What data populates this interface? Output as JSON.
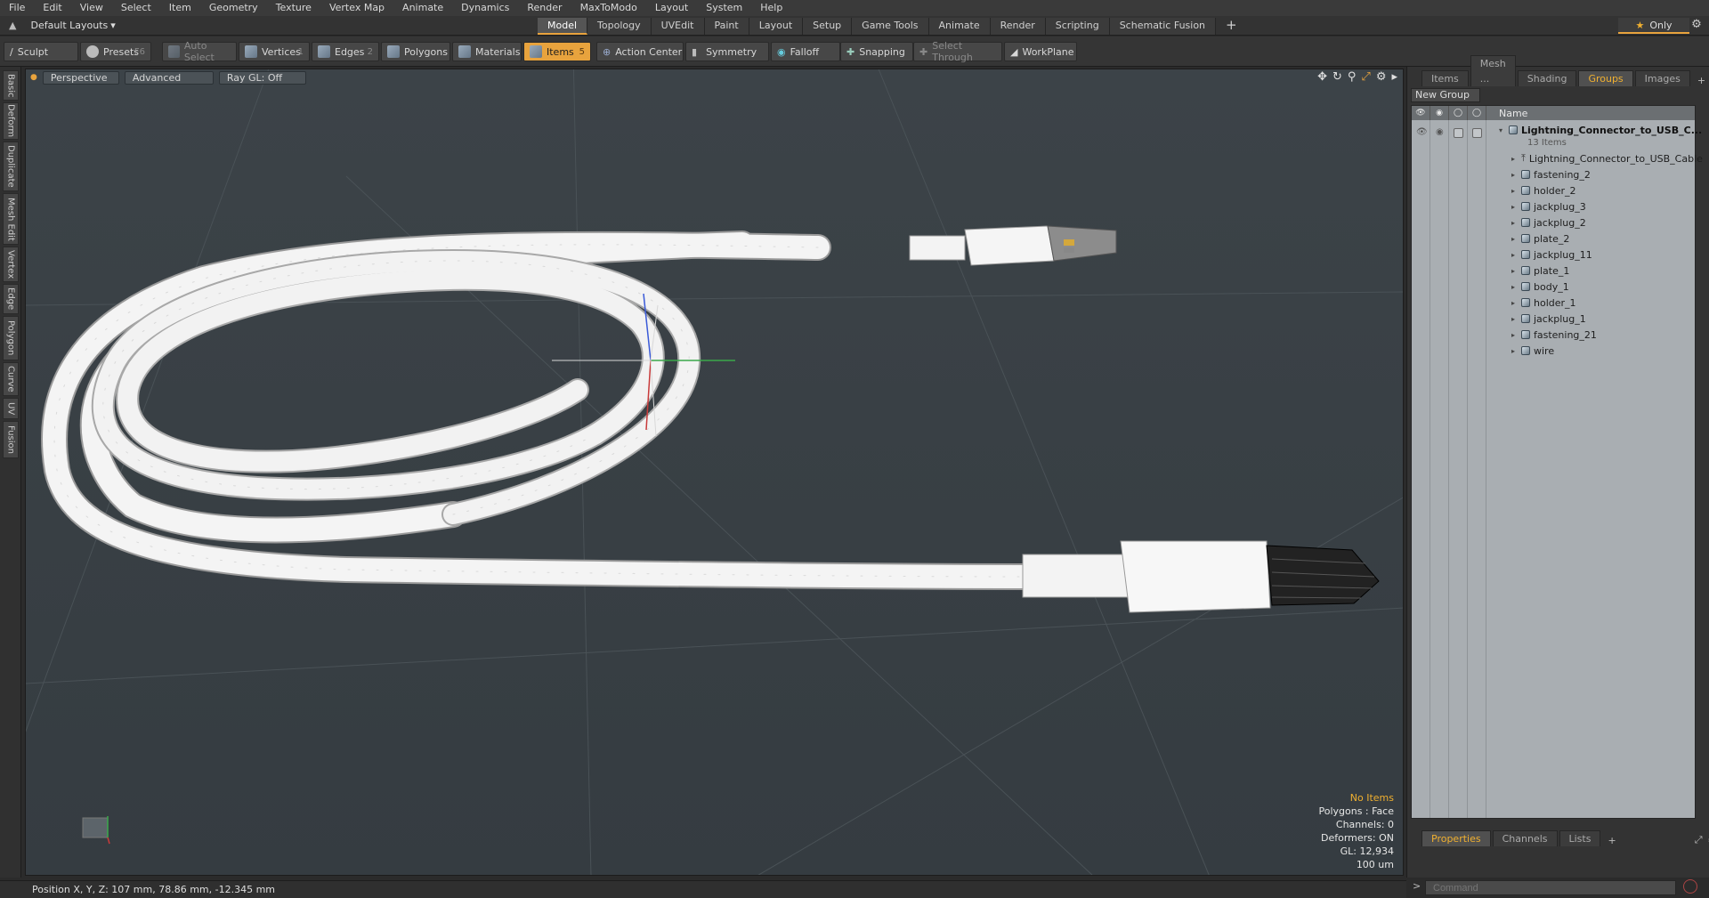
{
  "menu": [
    "File",
    "Edit",
    "View",
    "Select",
    "Item",
    "Geometry",
    "Texture",
    "Vertex Map",
    "Animate",
    "Dynamics",
    "Render",
    "MaxToModo",
    "Layout",
    "System",
    "Help"
  ],
  "layout_selector": "Default Layouts",
  "mode_tabs": [
    "Model",
    "Topology",
    "UVEdit",
    "Paint",
    "Layout",
    "Setup",
    "Game Tools",
    "Animate",
    "Render",
    "Scripting",
    "Schematic Fusion"
  ],
  "active_mode_tab": "Model",
  "only_label": "Only",
  "toolbar": {
    "sculpt": "Sculpt",
    "presets": "Presets",
    "presets_key": "F6",
    "auto_select": "Auto Select",
    "vertices": "Vertices",
    "vertices_key": "1",
    "edges": "Edges",
    "edges_key": "2",
    "polygons": "Polygons",
    "materials": "Materials",
    "items": "Items",
    "items_key": "5",
    "action_center": "Action Center",
    "symmetry": "Symmetry",
    "falloff": "Falloff",
    "snapping": "Snapping",
    "select_through": "Select Through",
    "workplane": "WorkPlane"
  },
  "left_tabs": [
    "Basic",
    "Deform",
    "Duplicate",
    "Mesh Edit",
    "Vertex",
    "Edge",
    "Polygon",
    "Curve",
    "UV",
    "Fusion"
  ],
  "viewport": {
    "view": "Perspective",
    "shading": "Advanced",
    "raygl": "Ray GL: Off",
    "info": {
      "selection": "No Items",
      "polygons": "Polygons : Face",
      "channels": "Channels: 0",
      "deformers": "Deformers: ON",
      "gl": "GL: 12,934",
      "scale": "100 um"
    }
  },
  "right_panel": {
    "tabs": [
      "Items",
      "Mesh ...",
      "Shading",
      "Groups",
      "Images"
    ],
    "active_tab": "Groups",
    "new_group": "New Group",
    "column_name": "Name",
    "root": {
      "name": "Lightning_Connector_to_USB_C...",
      "count": "13 Items"
    },
    "items": [
      "Lightning_Connector_to_USB_Cable",
      "fastening_2",
      "holder_2",
      "jackplug_3",
      "jackplug_2",
      "plate_2",
      "jackplug_11",
      "plate_1",
      "body_1",
      "holder_1",
      "jackplug_1",
      "fastening_21",
      "wire"
    ],
    "bottom_tabs": [
      "Properties",
      "Channels",
      "Lists"
    ],
    "active_bottom_tab": "Properties",
    "command_placeholder": "Command"
  },
  "status": "Position X, Y, Z:   107 mm, 78.86 mm, -12.345 mm",
  "colors": {
    "accent": "#e8a33d",
    "viewport_bg": "#3a4146",
    "list_bg": "#a9aeb2"
  }
}
